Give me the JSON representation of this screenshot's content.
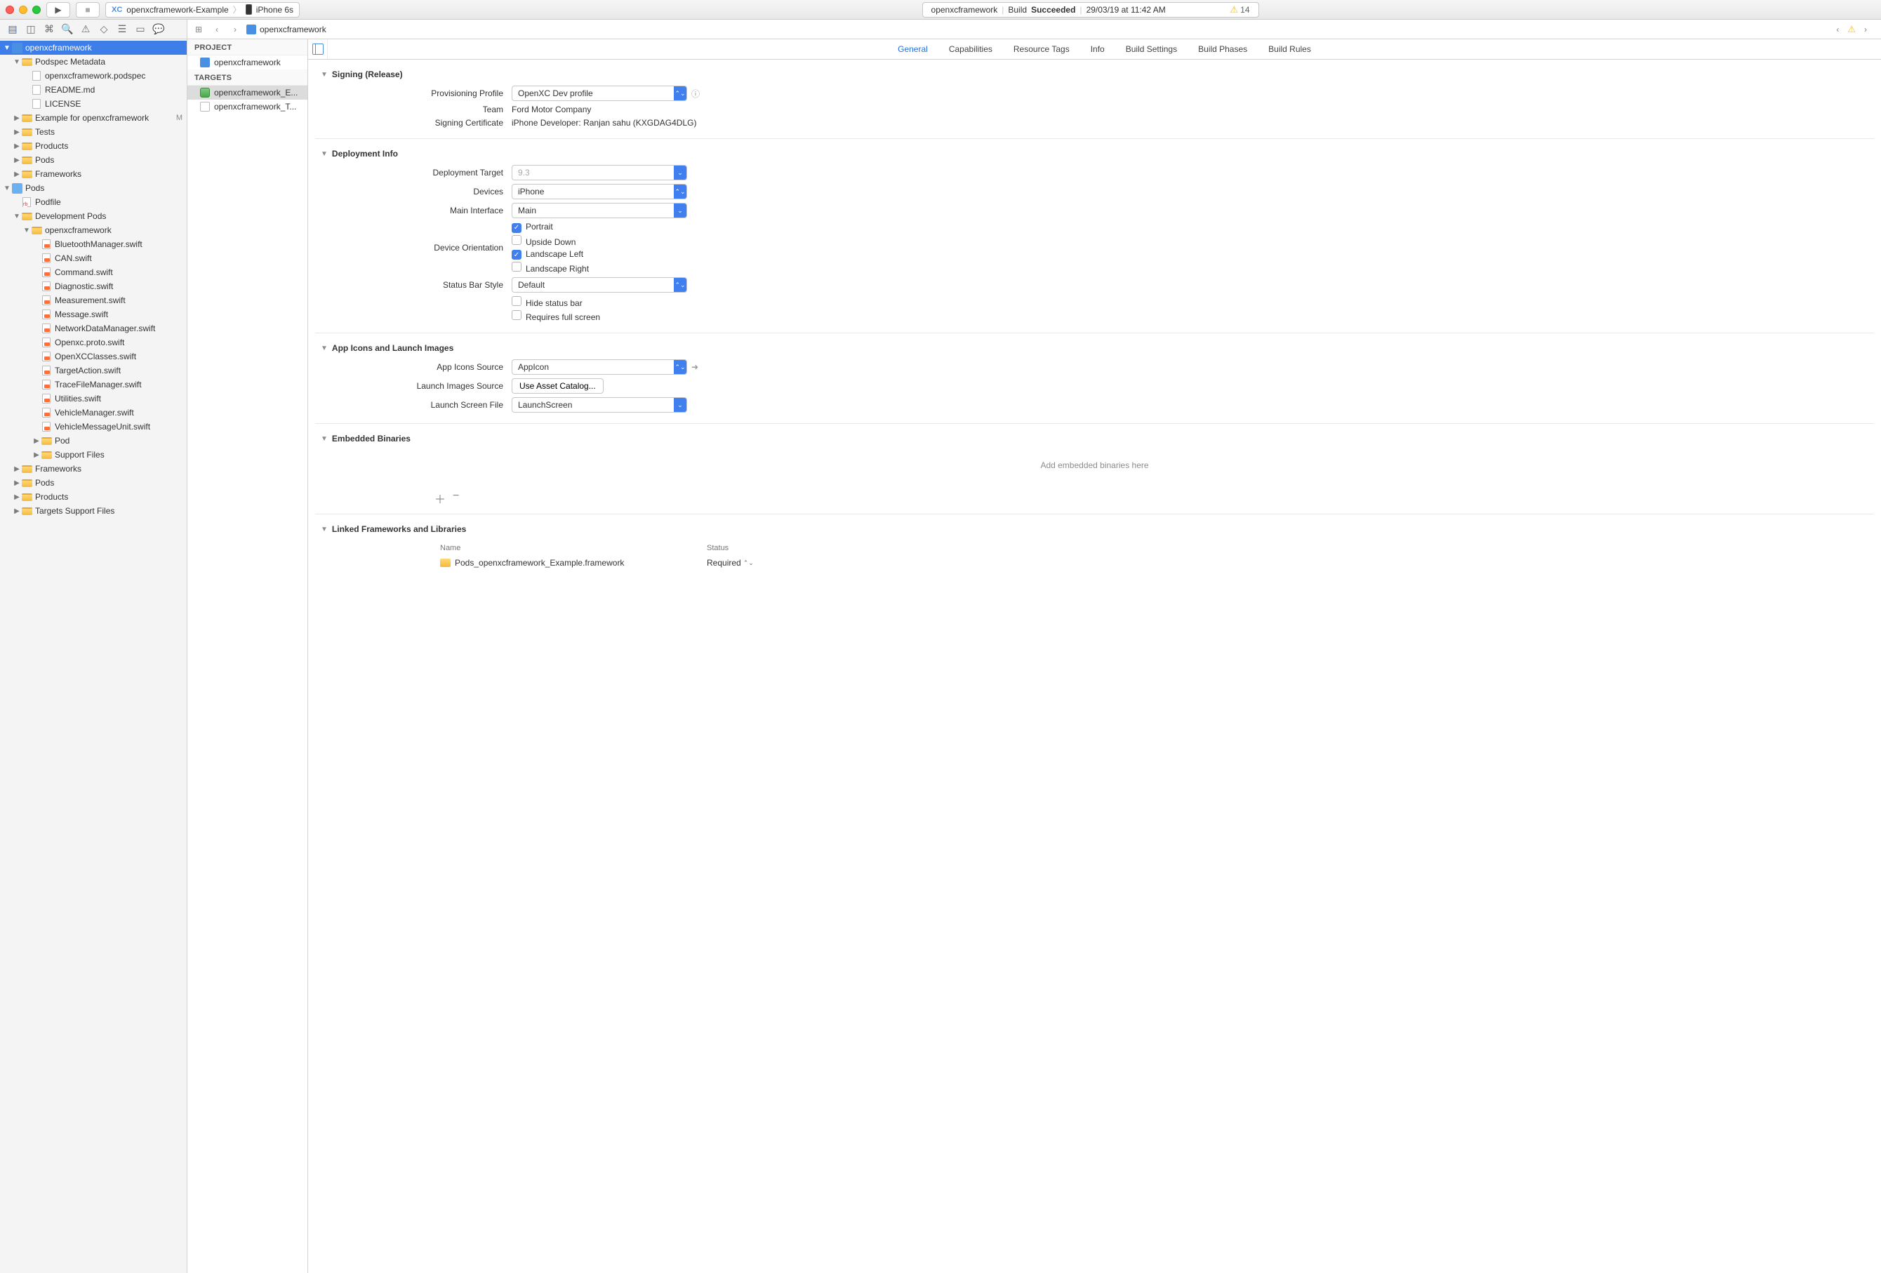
{
  "titlebar": {
    "scheme_project": "openxcframework-Example",
    "scheme_device": "iPhone 6s",
    "status_project": "openxcframework",
    "status_build_label": "Build",
    "status_build_result": "Succeeded",
    "status_date": "29/03/19 at 11:42 AM",
    "warning_count": "14"
  },
  "jumpbar": {
    "file": "openxcframework"
  },
  "navigator": {
    "root": "openxcframework",
    "podspec_group": "Podspec Metadata",
    "podspec_file": "openxcframework.podspec",
    "readme": "README.md",
    "license": "LICENSE",
    "example_group": "Example for openxcframework",
    "example_status": "M",
    "tests": "Tests",
    "products": "Products",
    "pods_group": "Pods",
    "frameworks": "Frameworks",
    "pods_proj": "Pods",
    "podfile": "Podfile",
    "dev_pods": "Development Pods",
    "dev_openxc": "openxcframework",
    "swift_files": [
      "BluetoothManager.swift",
      "CAN.swift",
      "Command.swift",
      "Diagnostic.swift",
      "Measurement.swift",
      "Message.swift",
      "NetworkDataManager.swift",
      "Openxc.proto.swift",
      "OpenXCClasses.swift",
      "TargetAction.swift",
      "TraceFileManager.swift",
      "Utilities.swift",
      "VehicleManager.swift",
      "VehicleMessageUnit.swift"
    ],
    "pod_folder": "Pod",
    "support_files": "Support Files",
    "frameworks2": "Frameworks",
    "pods2": "Pods",
    "products2": "Products",
    "targets_support": "Targets Support Files"
  },
  "middle": {
    "project_header": "PROJECT",
    "project_name": "openxcframework",
    "targets_header": "TARGETS",
    "target1": "openxcframework_E...",
    "target2": "openxcframework_T..."
  },
  "tabs": {
    "general": "General",
    "capabilities": "Capabilities",
    "resource_tags": "Resource Tags",
    "info": "Info",
    "build_settings": "Build Settings",
    "build_phases": "Build Phases",
    "build_rules": "Build Rules"
  },
  "signing": {
    "header": "Signing (Release)",
    "profile_label": "Provisioning Profile",
    "profile_value": "OpenXC Dev profile",
    "team_label": "Team",
    "team_value": "Ford Motor Company",
    "cert_label": "Signing Certificate",
    "cert_value": "iPhone Developer: Ranjan sahu (KXGDAG4DLG)"
  },
  "deployment": {
    "header": "Deployment Info",
    "target_label": "Deployment Target",
    "target_value": "9.3",
    "devices_label": "Devices",
    "devices_value": "iPhone",
    "main_interface_label": "Main Interface",
    "main_interface_value": "Main",
    "orientation_label": "Device Orientation",
    "portrait": "Portrait",
    "upside": "Upside Down",
    "landscape_left": "Landscape Left",
    "landscape_right": "Landscape Right",
    "statusbar_label": "Status Bar Style",
    "statusbar_value": "Default",
    "hide_status": "Hide status bar",
    "requires_full": "Requires full screen"
  },
  "appicons": {
    "header": "App Icons and Launch Images",
    "source_label": "App Icons Source",
    "source_value": "AppIcon",
    "launch_images_label": "Launch Images Source",
    "launch_images_btn": "Use Asset Catalog...",
    "launch_screen_label": "Launch Screen File",
    "launch_screen_value": "LaunchScreen"
  },
  "embedded": {
    "header": "Embedded Binaries",
    "hint": "Add embedded binaries here"
  },
  "linked": {
    "header": "Linked Frameworks and Libraries",
    "name_col": "Name",
    "status_col": "Status",
    "row1_name": "Pods_openxcframework_Example.framework",
    "row1_status": "Required"
  }
}
